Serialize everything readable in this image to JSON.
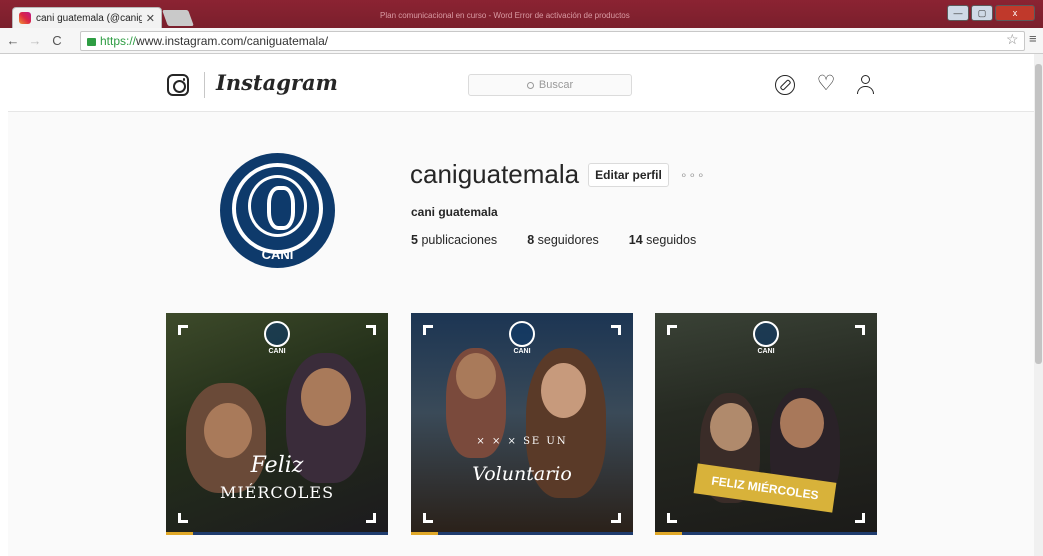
{
  "browser": {
    "tab_title": "cani guatemala (@canigu",
    "tab_close": "✕",
    "url_scheme": "https://",
    "url_rest": "www.instagram.com/caniguatemala/",
    "background_title": "Plan comunicacional en curso - Word Error de activación de productos",
    "back": "←",
    "forward": "→",
    "reload": "C",
    "star": "☆",
    "menu": "≡",
    "win_min": "—",
    "win_max": "▢",
    "win_close": "x"
  },
  "instagram": {
    "wordmark": "Instagram",
    "search_placeholder": "Buscar",
    "heart": "♡"
  },
  "profile": {
    "username": "caniguatemala",
    "edit_button": "Editar perfil",
    "more": "∘∘∘",
    "full_name": "cani guatemala",
    "avatar_label": "CANI",
    "stats": [
      {
        "count": "5",
        "label": "publicaciones"
      },
      {
        "count": "8",
        "label": "seguidores"
      },
      {
        "count": "14",
        "label": "seguidos"
      }
    ]
  },
  "posts": [
    {
      "badge": "CANI",
      "line1": "Feliz",
      "line2": "MIÉRCOLES"
    },
    {
      "badge": "CANI",
      "small": "× × ×  SE UN",
      "line1": "Voluntario"
    },
    {
      "badge": "CANI",
      "banner": "FELIZ MIÉRCOLES"
    }
  ],
  "colors": {
    "brand_navy": "#0e3a6b",
    "accent_gold": "#e0a828",
    "secure_green": "#2e9d43"
  }
}
